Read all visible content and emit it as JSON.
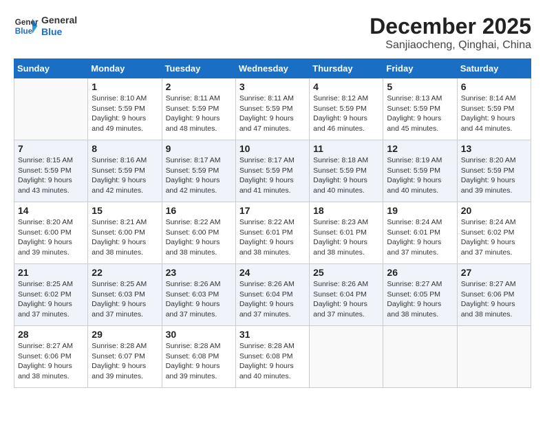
{
  "logo": {
    "line1": "General",
    "line2": "Blue"
  },
  "title": "December 2025",
  "subtitle": "Sanjiaocheng, Qinghai, China",
  "days_of_week": [
    "Sunday",
    "Monday",
    "Tuesday",
    "Wednesday",
    "Thursday",
    "Friday",
    "Saturday"
  ],
  "weeks": [
    [
      {
        "day": "",
        "info": ""
      },
      {
        "day": "1",
        "info": "Sunrise: 8:10 AM\nSunset: 5:59 PM\nDaylight: 9 hours\nand 49 minutes."
      },
      {
        "day": "2",
        "info": "Sunrise: 8:11 AM\nSunset: 5:59 PM\nDaylight: 9 hours\nand 48 minutes."
      },
      {
        "day": "3",
        "info": "Sunrise: 8:11 AM\nSunset: 5:59 PM\nDaylight: 9 hours\nand 47 minutes."
      },
      {
        "day": "4",
        "info": "Sunrise: 8:12 AM\nSunset: 5:59 PM\nDaylight: 9 hours\nand 46 minutes."
      },
      {
        "day": "5",
        "info": "Sunrise: 8:13 AM\nSunset: 5:59 PM\nDaylight: 9 hours\nand 45 minutes."
      },
      {
        "day": "6",
        "info": "Sunrise: 8:14 AM\nSunset: 5:59 PM\nDaylight: 9 hours\nand 44 minutes."
      }
    ],
    [
      {
        "day": "7",
        "info": "Sunrise: 8:15 AM\nSunset: 5:59 PM\nDaylight: 9 hours\nand 43 minutes."
      },
      {
        "day": "8",
        "info": "Sunrise: 8:16 AM\nSunset: 5:59 PM\nDaylight: 9 hours\nand 42 minutes."
      },
      {
        "day": "9",
        "info": "Sunrise: 8:17 AM\nSunset: 5:59 PM\nDaylight: 9 hours\nand 42 minutes."
      },
      {
        "day": "10",
        "info": "Sunrise: 8:17 AM\nSunset: 5:59 PM\nDaylight: 9 hours\nand 41 minutes."
      },
      {
        "day": "11",
        "info": "Sunrise: 8:18 AM\nSunset: 5:59 PM\nDaylight: 9 hours\nand 40 minutes."
      },
      {
        "day": "12",
        "info": "Sunrise: 8:19 AM\nSunset: 5:59 PM\nDaylight: 9 hours\nand 40 minutes."
      },
      {
        "day": "13",
        "info": "Sunrise: 8:20 AM\nSunset: 5:59 PM\nDaylight: 9 hours\nand 39 minutes."
      }
    ],
    [
      {
        "day": "14",
        "info": "Sunrise: 8:20 AM\nSunset: 6:00 PM\nDaylight: 9 hours\nand 39 minutes."
      },
      {
        "day": "15",
        "info": "Sunrise: 8:21 AM\nSunset: 6:00 PM\nDaylight: 9 hours\nand 38 minutes."
      },
      {
        "day": "16",
        "info": "Sunrise: 8:22 AM\nSunset: 6:00 PM\nDaylight: 9 hours\nand 38 minutes."
      },
      {
        "day": "17",
        "info": "Sunrise: 8:22 AM\nSunset: 6:01 PM\nDaylight: 9 hours\nand 38 minutes."
      },
      {
        "day": "18",
        "info": "Sunrise: 8:23 AM\nSunset: 6:01 PM\nDaylight: 9 hours\nand 38 minutes."
      },
      {
        "day": "19",
        "info": "Sunrise: 8:24 AM\nSunset: 6:01 PM\nDaylight: 9 hours\nand 37 minutes."
      },
      {
        "day": "20",
        "info": "Sunrise: 8:24 AM\nSunset: 6:02 PM\nDaylight: 9 hours\nand 37 minutes."
      }
    ],
    [
      {
        "day": "21",
        "info": "Sunrise: 8:25 AM\nSunset: 6:02 PM\nDaylight: 9 hours\nand 37 minutes."
      },
      {
        "day": "22",
        "info": "Sunrise: 8:25 AM\nSunset: 6:03 PM\nDaylight: 9 hours\nand 37 minutes."
      },
      {
        "day": "23",
        "info": "Sunrise: 8:26 AM\nSunset: 6:03 PM\nDaylight: 9 hours\nand 37 minutes."
      },
      {
        "day": "24",
        "info": "Sunrise: 8:26 AM\nSunset: 6:04 PM\nDaylight: 9 hours\nand 37 minutes."
      },
      {
        "day": "25",
        "info": "Sunrise: 8:26 AM\nSunset: 6:04 PM\nDaylight: 9 hours\nand 37 minutes."
      },
      {
        "day": "26",
        "info": "Sunrise: 8:27 AM\nSunset: 6:05 PM\nDaylight: 9 hours\nand 38 minutes."
      },
      {
        "day": "27",
        "info": "Sunrise: 8:27 AM\nSunset: 6:06 PM\nDaylight: 9 hours\nand 38 minutes."
      }
    ],
    [
      {
        "day": "28",
        "info": "Sunrise: 8:27 AM\nSunset: 6:06 PM\nDaylight: 9 hours\nand 38 minutes."
      },
      {
        "day": "29",
        "info": "Sunrise: 8:28 AM\nSunset: 6:07 PM\nDaylight: 9 hours\nand 39 minutes."
      },
      {
        "day": "30",
        "info": "Sunrise: 8:28 AM\nSunset: 6:08 PM\nDaylight: 9 hours\nand 39 minutes."
      },
      {
        "day": "31",
        "info": "Sunrise: 8:28 AM\nSunset: 6:08 PM\nDaylight: 9 hours\nand 40 minutes."
      },
      {
        "day": "",
        "info": ""
      },
      {
        "day": "",
        "info": ""
      },
      {
        "day": "",
        "info": ""
      }
    ]
  ]
}
